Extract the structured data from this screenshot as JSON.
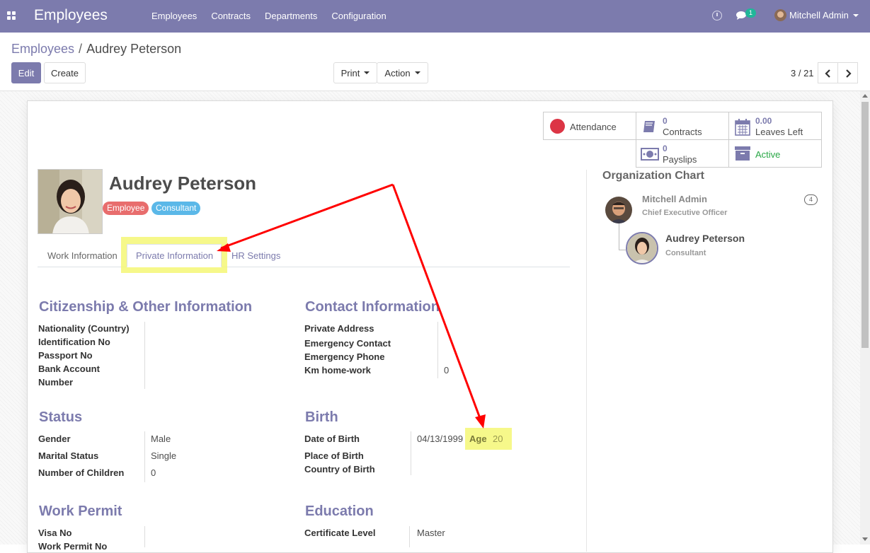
{
  "navbar": {
    "app_title": "Employees",
    "menu": [
      "Employees",
      "Contracts",
      "Departments",
      "Configuration"
    ],
    "chat_badge": "1",
    "user_name": "Mitchell Admin"
  },
  "breadcrumb": {
    "parent": "Employees",
    "separator": "/",
    "current": "Audrey Peterson"
  },
  "control_panel": {
    "edit_label": "Edit",
    "create_label": "Create",
    "print_label": "Print",
    "action_label": "Action",
    "pager": "3 / 21"
  },
  "smart_buttons": {
    "attendance": "Attendance",
    "contracts_count": "0",
    "contracts_label": "Contracts",
    "leaves_count": "0.00",
    "leaves_label": "Leaves Left",
    "payslips_count": "0",
    "payslips_label": "Payslips",
    "active_label": "Active"
  },
  "employee": {
    "name": "Audrey Peterson",
    "tags": [
      "Employee",
      "Consultant"
    ]
  },
  "tabs": [
    "Work Information",
    "Private Information",
    "HR Settings"
  ],
  "citizenship": {
    "title": "Citizenship & Other Information",
    "labels": [
      "Nationality (Country)",
      "Identification No",
      "Passport No",
      "Bank Account",
      "Number"
    ]
  },
  "contact": {
    "title": "Contact Information",
    "labels": [
      "Private Address",
      "Emergency Contact",
      "Emergency Phone",
      "Km home-work"
    ],
    "km_value": "0"
  },
  "status": {
    "title": "Status",
    "gender_label": "Gender",
    "gender_value": "Male",
    "marital_label": "Marital Status",
    "marital_value": "Single",
    "children_label": "Number of Children",
    "children_value": "0"
  },
  "birth": {
    "title": "Birth",
    "dob_label": "Date of Birth",
    "dob_value": "04/13/1999",
    "age_label": "Age",
    "age_value": "20",
    "place_label": "Place of Birth",
    "country_label": "Country of Birth"
  },
  "work_permit": {
    "title": "Work Permit",
    "visa_label": "Visa No",
    "permit_label": "Work Permit No"
  },
  "education": {
    "title": "Education",
    "certificate_label": "Certificate Level",
    "certificate_value": "Master"
  },
  "org_chart": {
    "title": "Organization Chart",
    "manager_name": "Mitchell Admin",
    "manager_job": "Chief Executive Officer",
    "manager_count": "4",
    "self_name": "Audrey Peterson",
    "self_job": "Consultant"
  },
  "colors": {
    "brand": "#7c7bad",
    "tag_employee": "#e86d6d",
    "tag_consultant": "#5bb8e8",
    "attendance_dot": "#dc3545",
    "active_green": "#28a745",
    "highlight": "#f4f776",
    "annotation_arrow": "#ff0000"
  }
}
